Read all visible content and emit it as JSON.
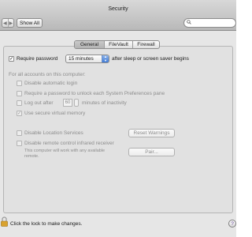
{
  "window": {
    "title": "Security"
  },
  "toolbar": {
    "nav_back": "◀",
    "nav_forward": "▶",
    "show_all_label": "Show All",
    "search_value": ""
  },
  "tabs": [
    {
      "label": "General",
      "selected": true
    },
    {
      "label": "FileVault",
      "selected": false
    },
    {
      "label": "Firewall",
      "selected": false
    }
  ],
  "general": {
    "require_password": {
      "checked": true,
      "label": "Require password",
      "suffix": "after sleep or screen saver begins"
    },
    "password_delay": {
      "selected": "15 minutes"
    },
    "all_accounts_header": "For all accounts on this computer:",
    "options": [
      {
        "label": "Disable automatic login",
        "checked": false,
        "disabled": true
      },
      {
        "label": "Require a password to unlock each System Preferences pane",
        "checked": false,
        "disabled": true
      },
      {
        "label": "Log out after",
        "checked": false,
        "disabled": true
      },
      {
        "label": "Use secure virtual memory",
        "checked": true,
        "disabled": true
      },
      {
        "label": "Disable Location Services",
        "checked": false,
        "disabled": true
      },
      {
        "label": "Disable remote control infrared receiver",
        "checked": false,
        "disabled": true
      }
    ],
    "logout": {
      "minutes": "60",
      "suffix": "minutes of inactivity"
    },
    "reset_warnings_label": "Reset Warnings",
    "infrared_note_line1": "This computer will work with any available",
    "infrared_note_line2": "remote.",
    "pair_label": "Pair..."
  },
  "footer": {
    "lock_text": "Click the lock to make changes.",
    "help_label": "?"
  },
  "icons": {
    "lock": "lock-icon",
    "search": "search-icon",
    "help": "help-icon"
  },
  "colors": {
    "accent": "#3f7ad6",
    "disabled_text": "#8c8c8c",
    "lock_gold": "#d9a22e"
  }
}
